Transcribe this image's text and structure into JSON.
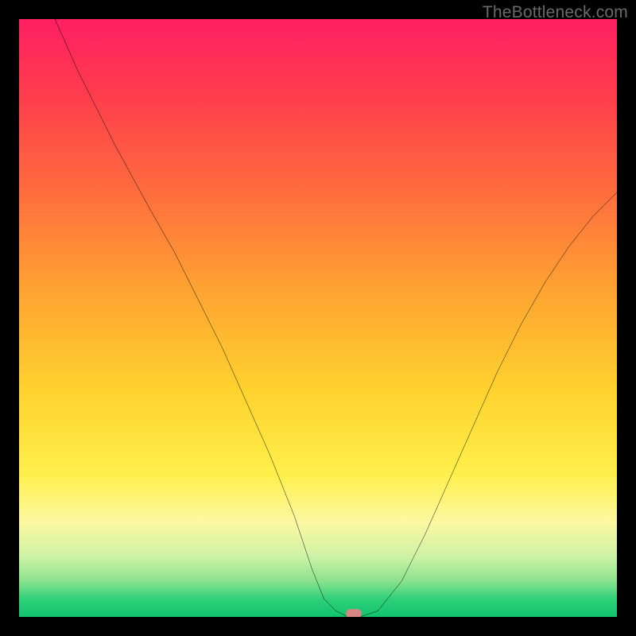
{
  "watermark": "TheBottleneck.com",
  "colors": {
    "curve_stroke": "#000000",
    "marker_fill": "#d58784",
    "page_bg": "#000000"
  },
  "chart_data": {
    "type": "line",
    "title": "",
    "xlabel": "",
    "ylabel": "",
    "xlim": [
      0,
      100
    ],
    "ylim": [
      0,
      100
    ],
    "grid": false,
    "legend": false,
    "series": [
      {
        "name": "bottleneck-curve",
        "x": [
          6,
          10,
          16,
          22,
          26,
          30,
          34,
          38,
          42,
          46,
          49,
          51,
          53,
          55,
          57,
          60,
          64,
          68,
          72,
          76,
          80,
          84,
          88,
          92,
          96,
          100
        ],
        "values": [
          100,
          91,
          79,
          68,
          61,
          53,
          45,
          36,
          27,
          17,
          8,
          3,
          1,
          0,
          0,
          1,
          6,
          14,
          23,
          32,
          41,
          49,
          56,
          62,
          67,
          71
        ]
      }
    ],
    "markers": [
      {
        "name": "min-point-marker",
        "x": 56,
        "y": 0.5
      }
    ]
  }
}
